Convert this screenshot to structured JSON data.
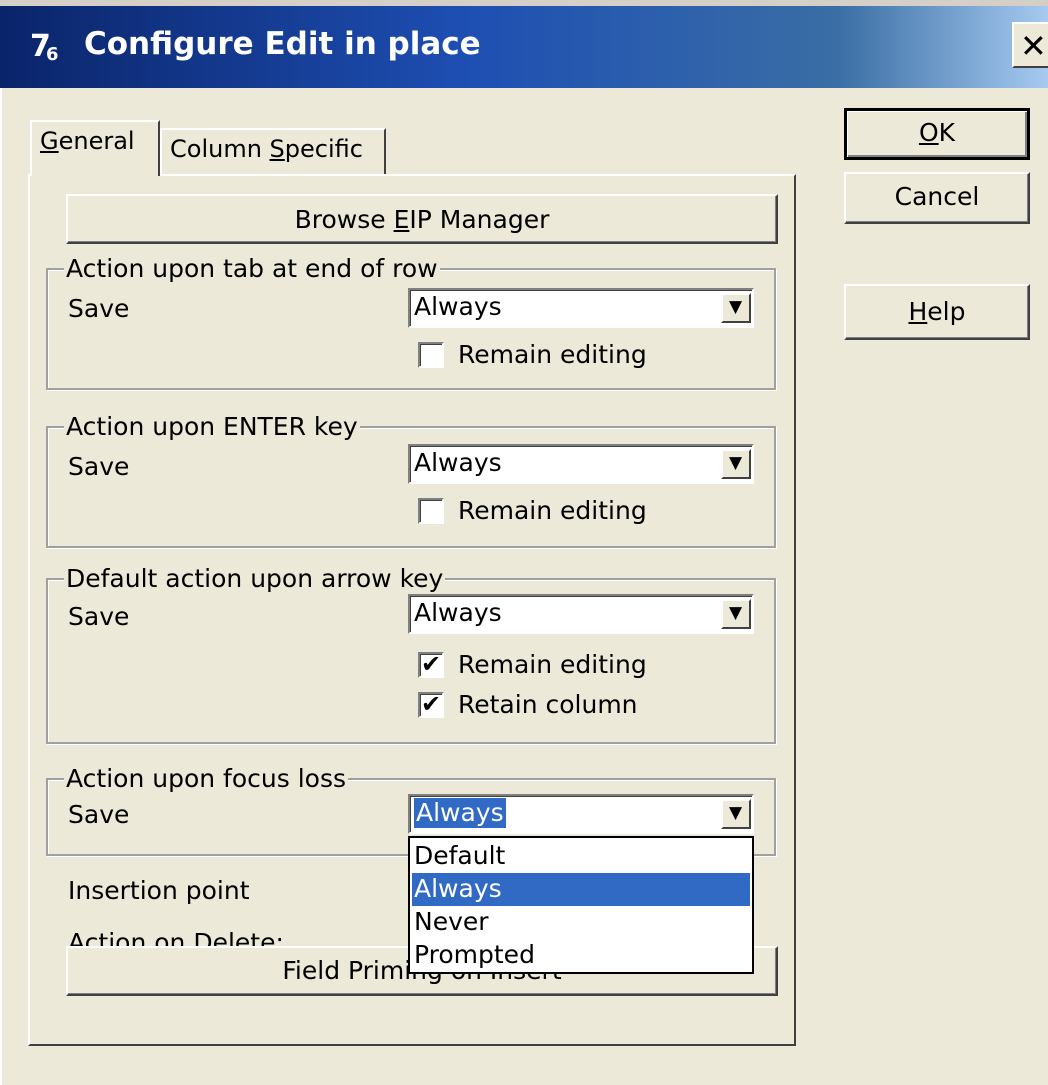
{
  "window": {
    "title": "Configure Edit in place",
    "close_glyph": "✕",
    "icon": "app-icon"
  },
  "buttons": {
    "ok": "OK",
    "ok_mnemonic": "O",
    "ok_rest": "K",
    "cancel": "Cancel",
    "help_mnemonic": "H",
    "help_rest": "elp"
  },
  "tabs": [
    {
      "mnemonic": "G",
      "rest": "eneral",
      "active": true
    },
    {
      "prefix": "Column ",
      "mnemonic": "S",
      "rest": "pecific",
      "active": false
    }
  ],
  "general": {
    "browse_prefix": "Browse ",
    "browse_mnemonic": "E",
    "browse_rest": "IP Manager",
    "groups": [
      {
        "title": "Action upon tab at end of row",
        "save_label": "Save",
        "save_value": "Always",
        "checks": [
          {
            "label": "Remain editing",
            "checked": false
          }
        ]
      },
      {
        "title": "Action upon ENTER key",
        "save_label": "Save",
        "save_value": "Always",
        "checks": [
          {
            "label": "Remain editing",
            "checked": false
          }
        ]
      },
      {
        "title": "Default action upon arrow key",
        "save_label": "Save",
        "save_value": "Always",
        "checks": [
          {
            "label": "Remain editing",
            "checked": true
          },
          {
            "label": "Retain column",
            "checked": true
          }
        ]
      },
      {
        "title": "Action upon focus loss",
        "save_label": "Save",
        "save_value": "Always",
        "checks": []
      }
    ],
    "insertion_point_label": "Insertion point",
    "action_on_delete_label": "Action on Delete:",
    "field_priming_label": "Field Priming on Insert"
  },
  "dropdown": {
    "options": [
      "Default",
      "Always",
      "Never",
      "Prompted"
    ],
    "highlighted": "Always"
  },
  "colors": {
    "face": "#ece9d8",
    "title_start": "#0a246a",
    "title_end": "#a6caf0",
    "selection": "#316ac5"
  },
  "glyphs": {
    "check": "✔",
    "arrow": "▼"
  }
}
